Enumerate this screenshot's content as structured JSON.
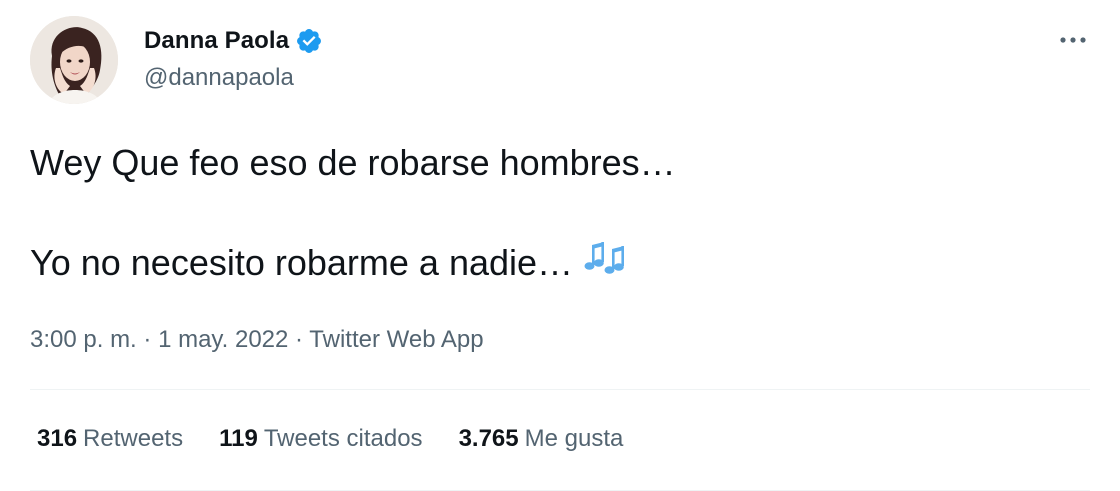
{
  "author": {
    "display_name": "Danna Paola",
    "handle": "@dannapaola",
    "verified": true,
    "avatar_icon": "profile-photo"
  },
  "tweet": {
    "line1": "Wey Que feo eso de robarse hombres…",
    "line2": "Yo no necesito robarme a nadie…",
    "emoji_icon": "musical-notes-icon"
  },
  "meta": {
    "time": "3:00 p. m.",
    "separator": " · ",
    "date": "1 may. 2022",
    "source": "Twitter Web App"
  },
  "stats": [
    {
      "count": "316",
      "label": "Retweets"
    },
    {
      "count": "119",
      "label": "Tweets citados"
    },
    {
      "count": "3.765",
      "label": "Me gusta"
    }
  ],
  "colors": {
    "text": "#0f1419",
    "secondary": "#536471",
    "verified_blue": "#1d9bf0",
    "divider": "#eff3f4"
  }
}
